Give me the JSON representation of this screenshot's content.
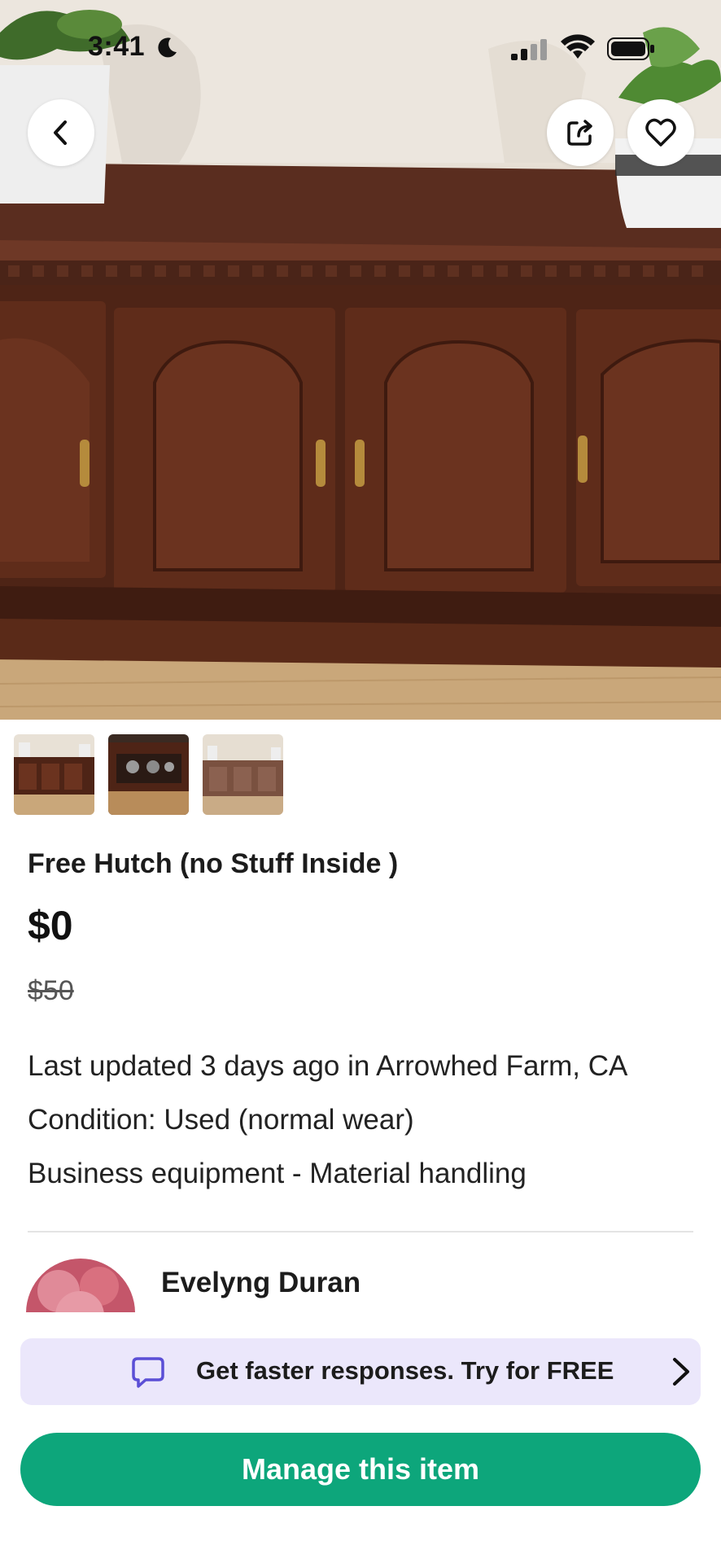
{
  "status_bar": {
    "time": "3:41",
    "icons": [
      "moon-icon",
      "cellular-signal-icon",
      "wifi-icon",
      "battery-icon"
    ]
  },
  "header": {
    "back_icon": "chevron-left-icon",
    "share_icon": "share-icon",
    "favorite_icon": "heart-icon"
  },
  "listing": {
    "title": "Free Hutch (no Stuff Inside )",
    "price": "$0",
    "original_price": "$50",
    "updated": "Last updated 3 days ago in Arrowhed Farm, CA",
    "condition": "Condition: Used (normal wear)",
    "category": "Business equipment - Material handling",
    "thumbnail_count": 3
  },
  "seller": {
    "name": "Evelyng Duran"
  },
  "promo": {
    "text": "Get faster responses.  Try for FREE",
    "icon": "chat-bubble-icon",
    "accent": "#5b4fd6",
    "background": "#ebe7fb"
  },
  "cta": {
    "label": "Manage this item",
    "color": "#0da67b"
  }
}
